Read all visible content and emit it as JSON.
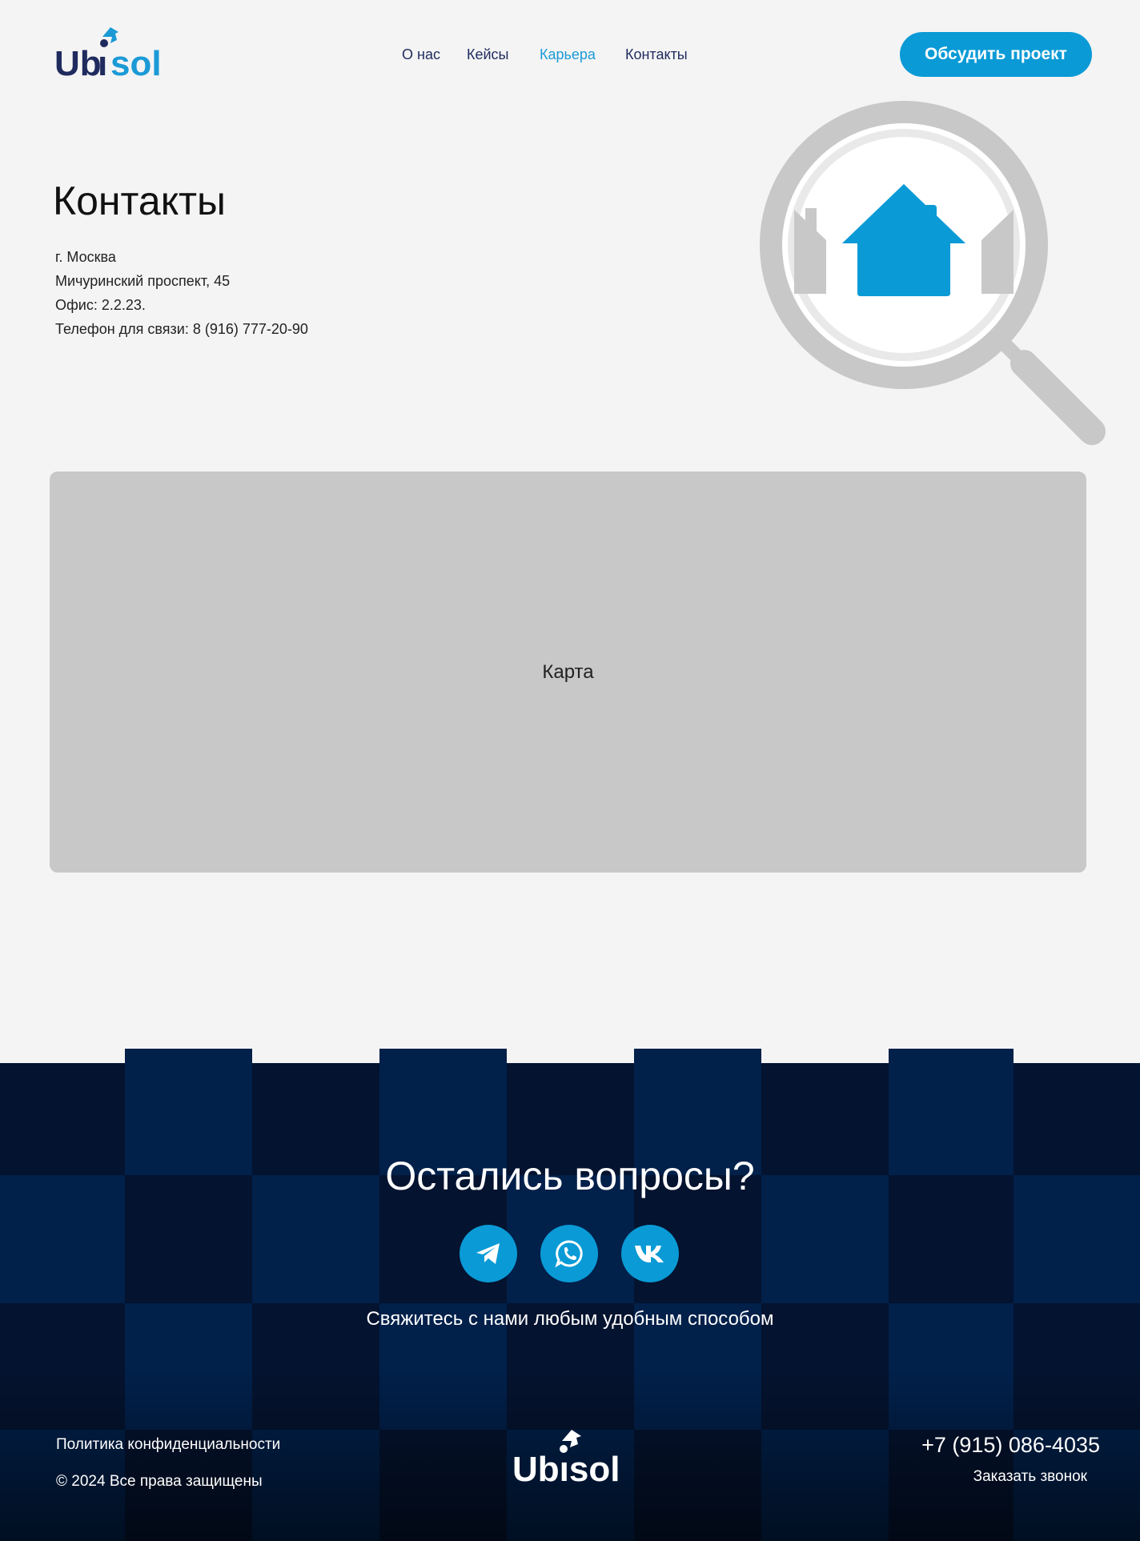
{
  "brand": {
    "name": "Ubisol",
    "primary_color": "#0a9ad6",
    "dark_color": "#1f2b5e"
  },
  "header": {
    "nav": [
      {
        "label": "О нас",
        "active": false
      },
      {
        "label": "Кейсы",
        "active": false
      },
      {
        "label": "Карьера",
        "active": true
      },
      {
        "label": "Контакты",
        "active": false
      }
    ],
    "cta_label": "Обсудить проект"
  },
  "contacts": {
    "title": "Контакты",
    "lines": [
      "г. Москва",
      "Мичуринский проспект, 45",
      "Офис: 2.2.23.",
      "Телефон для связи: 8 (916) 777-20-90"
    ],
    "illustration": "magnifier-house-icon"
  },
  "map": {
    "label": "Карта"
  },
  "footer": {
    "title": "Остались вопросы?",
    "socials": [
      {
        "name": "telegram-icon"
      },
      {
        "name": "whatsapp-icon"
      },
      {
        "name": "vk-icon"
      }
    ],
    "subtitle": "Свяжитесь с нами любым удобным способом",
    "policy": "Политика конфиденциальности",
    "copyright": "© 2024 Все права защищены",
    "phone": "+7 (915) 086-4035",
    "callback": "Заказать звонок",
    "bg_dark": "#04132f",
    "bg_light": "#01204a"
  }
}
